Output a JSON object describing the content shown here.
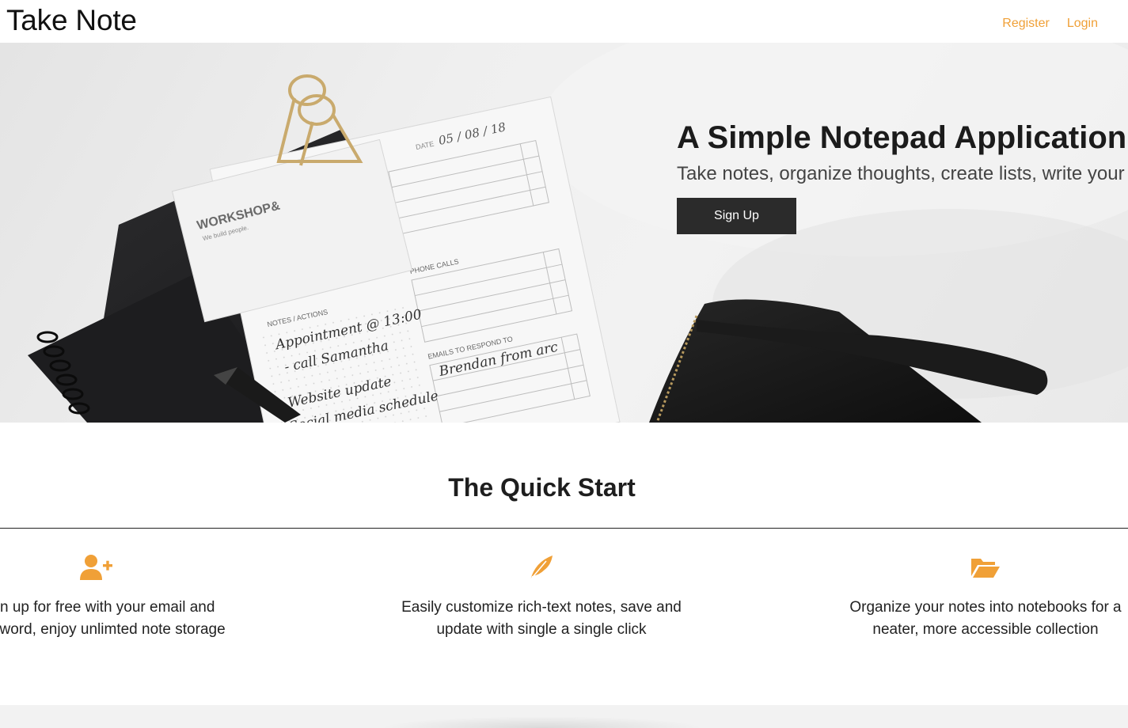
{
  "header": {
    "brand": "Take Note",
    "nav": {
      "register": "Register",
      "login": "Login"
    }
  },
  "hero": {
    "title": "A Simple Notepad Application",
    "subtitle": "Take notes, organize thoughts, create lists, write your",
    "signup_label": "Sign Up",
    "photo_text": {
      "card_brand": "WORKSHOP&",
      "card_tagline": "We build people.",
      "date_label": "DATE",
      "date_value": "05 / 08 / 18",
      "notes_heading": "NOTES / ACTIONS",
      "note_1": "Appointment @ 13:00",
      "note_2": "- call Samantha",
      "note_3": "Website update",
      "note_4": "Social media schedule",
      "phone_heading": "PHONE CALLS",
      "emails_heading": "EMAILS TO RESPOND TO",
      "email_1": "Brendan from arc"
    }
  },
  "quickstart": {
    "title": "The Quick Start",
    "features": [
      {
        "icon": "user-plus-icon",
        "text_line1": "Sign up for free with your email and",
        "text_line2": "password, enjoy unlimted note storage"
      },
      {
        "icon": "feather-icon",
        "text_line1": "Easily customize rich-text notes, save and",
        "text_line2": "update with single a single click"
      },
      {
        "icon": "folder-open-icon",
        "text_line1": "Organize your notes into notebooks for a",
        "text_line2": "neater, more accessible collection"
      }
    ]
  },
  "colors": {
    "accent": "#f0a037",
    "button_bg": "#2b2b2b",
    "footer_band": "#f2f2f2"
  }
}
